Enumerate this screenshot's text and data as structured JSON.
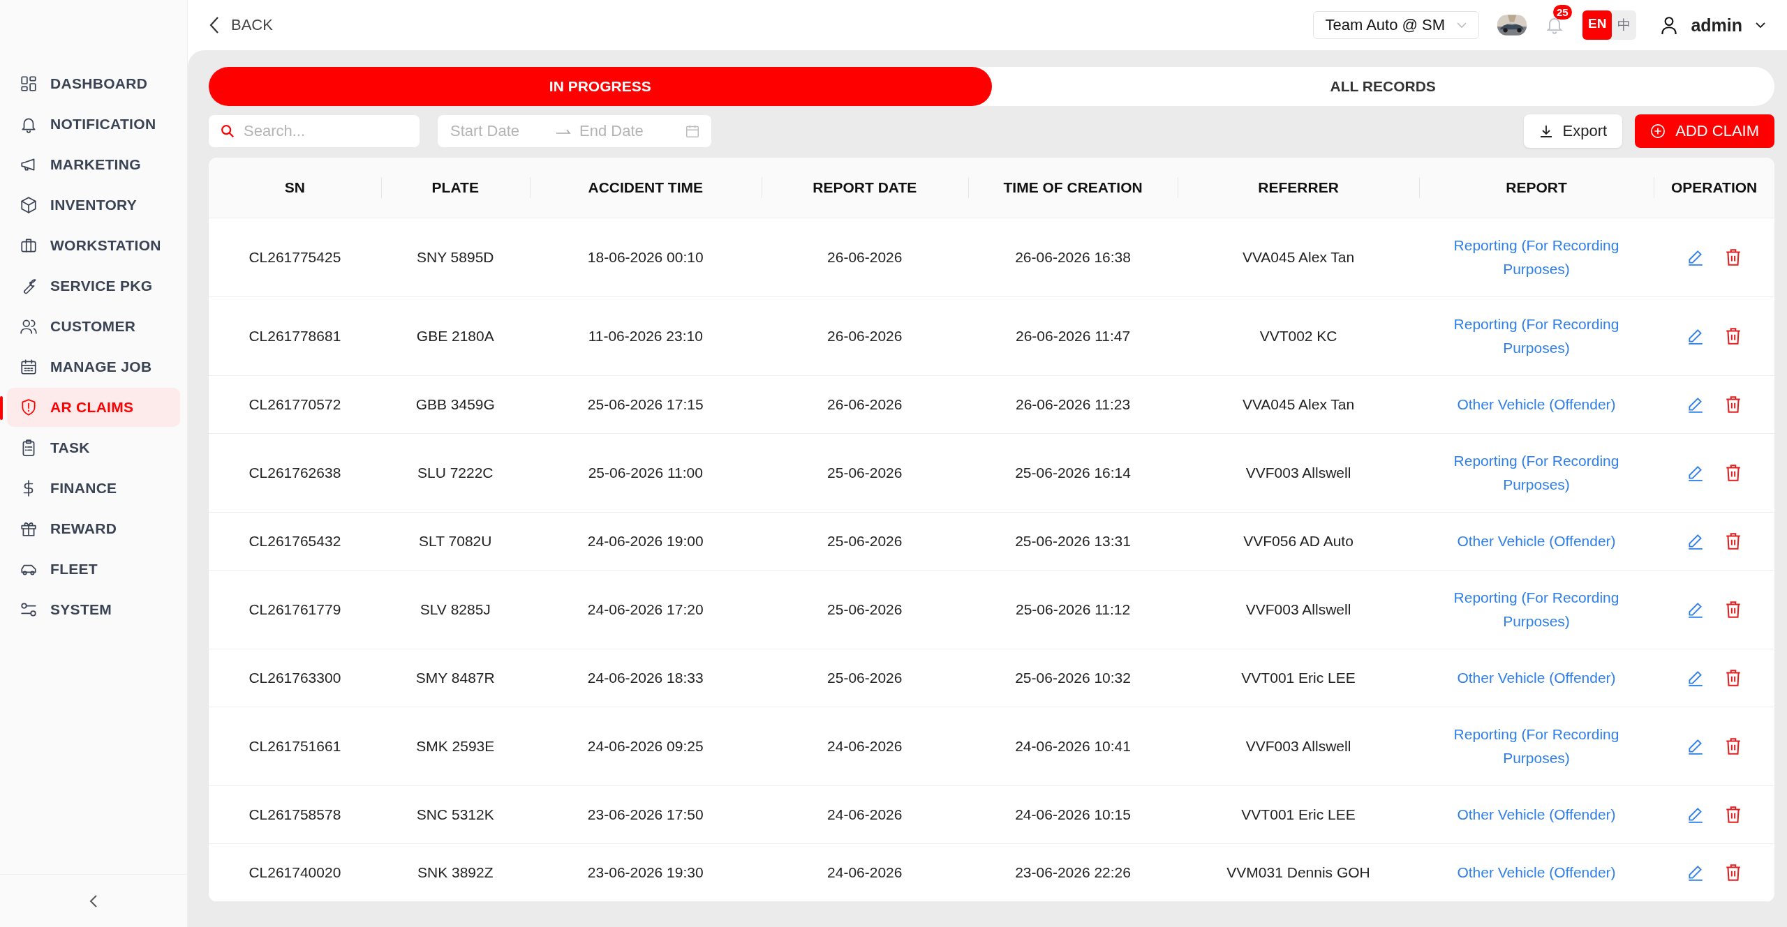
{
  "sidebar": {
    "items": [
      {
        "label": "DASHBOARD",
        "selected": false
      },
      {
        "label": "NOTIFICATION",
        "selected": false
      },
      {
        "label": "MARKETING",
        "selected": false
      },
      {
        "label": "INVENTORY",
        "selected": false
      },
      {
        "label": "WORKSTATION",
        "selected": false
      },
      {
        "label": "SERVICE PKG",
        "selected": false
      },
      {
        "label": "CUSTOMER",
        "selected": false
      },
      {
        "label": "MANAGE JOB",
        "selected": false
      },
      {
        "label": "AR CLAIMS",
        "selected": true
      },
      {
        "label": "TASK",
        "selected": false
      },
      {
        "label": "FINANCE",
        "selected": false
      },
      {
        "label": "REWARD",
        "selected": false
      },
      {
        "label": "FLEET",
        "selected": false
      },
      {
        "label": "SYSTEM",
        "selected": false
      }
    ]
  },
  "topbar": {
    "back": "BACK",
    "workshop": "Team Auto @ SM",
    "notifications": "25",
    "languages": [
      {
        "label": "EN",
        "selected": true
      },
      {
        "label": "中",
        "selected": false
      }
    ],
    "user": "admin"
  },
  "tabs": [
    {
      "label": "IN PROGRESS",
      "selected": true
    },
    {
      "label": "ALL RECORDS",
      "selected": false
    }
  ],
  "filters": {
    "search": {
      "placeholder": "Search..."
    },
    "start_date": {
      "placeholder": "Start Date"
    },
    "end_date": {
      "placeholder": "End Date"
    }
  },
  "actions": {
    "export": "Export",
    "add": "ADD CLAIM"
  },
  "table": {
    "columns": [
      "SN",
      "PLATE",
      "ACCIDENT TIME",
      "REPORT DATE",
      "TIME OF CREATION",
      "REFERRER",
      "REPORT",
      "OPERATION"
    ],
    "rows": [
      {
        "sn": "CL261775425",
        "plate": "SNY 5895D",
        "accident_time": "18-06-2026 00:10",
        "report_date": "26-06-2026",
        "created": "26-06-2026 16:38",
        "referrer": "VVA045 Alex Tan",
        "report": "Reporting (For Recording Purposes)"
      },
      {
        "sn": "CL261778681",
        "plate": "GBE 2180A",
        "accident_time": "11-06-2026 23:10",
        "report_date": "26-06-2026",
        "created": "26-06-2026 11:47",
        "referrer": "VVT002 KC",
        "report": "Reporting (For Recording Purposes)"
      },
      {
        "sn": "CL261770572",
        "plate": "GBB 3459G",
        "accident_time": "25-06-2026 17:15",
        "report_date": "26-06-2026",
        "created": "26-06-2026 11:23",
        "referrer": "VVA045 Alex Tan",
        "report": "Other Vehicle (Offender)"
      },
      {
        "sn": "CL261762638",
        "plate": "SLU 7222C",
        "accident_time": "25-06-2026 11:00",
        "report_date": "25-06-2026",
        "created": "25-06-2026 16:14",
        "referrer": "VVF003 Allswell",
        "report": "Reporting (For Recording Purposes)"
      },
      {
        "sn": "CL261765432",
        "plate": "SLT 7082U",
        "accident_time": "24-06-2026 19:00",
        "report_date": "25-06-2026",
        "created": "25-06-2026 13:31",
        "referrer": "VVF056 AD Auto",
        "report": "Other Vehicle (Offender)"
      },
      {
        "sn": "CL261761779",
        "plate": "SLV 8285J",
        "accident_time": "24-06-2026 17:20",
        "report_date": "25-06-2026",
        "created": "25-06-2026 11:12",
        "referrer": "VVF003 Allswell",
        "report": "Reporting (For Recording Purposes)"
      },
      {
        "sn": "CL261763300",
        "plate": "SMY 8487R",
        "accident_time": "24-06-2026 18:33",
        "report_date": "25-06-2026",
        "created": "25-06-2026 10:32",
        "referrer": "VVT001 Eric LEE",
        "report": "Other Vehicle (Offender)"
      },
      {
        "sn": "CL261751661",
        "plate": "SMK 2593E",
        "accident_time": "24-06-2026 09:25",
        "report_date": "24-06-2026",
        "created": "24-06-2026 10:41",
        "referrer": "VVF003 Allswell",
        "report": "Reporting (For Recording Purposes)"
      },
      {
        "sn": "CL261758578",
        "plate": "SNC 5312K",
        "accident_time": "23-06-2026 17:50",
        "report_date": "24-06-2026",
        "created": "24-06-2026 10:15",
        "referrer": "VVT001 Eric LEE",
        "report": "Other Vehicle (Offender)"
      },
      {
        "sn": "CL261740020",
        "plate": "SNK 3892Z",
        "accident_time": "23-06-2026 19:30",
        "report_date": "24-06-2026",
        "created": "23-06-2026 22:26",
        "referrer": "VVM031 Dennis GOH",
        "report": "Other Vehicle (Offender)"
      }
    ]
  }
}
